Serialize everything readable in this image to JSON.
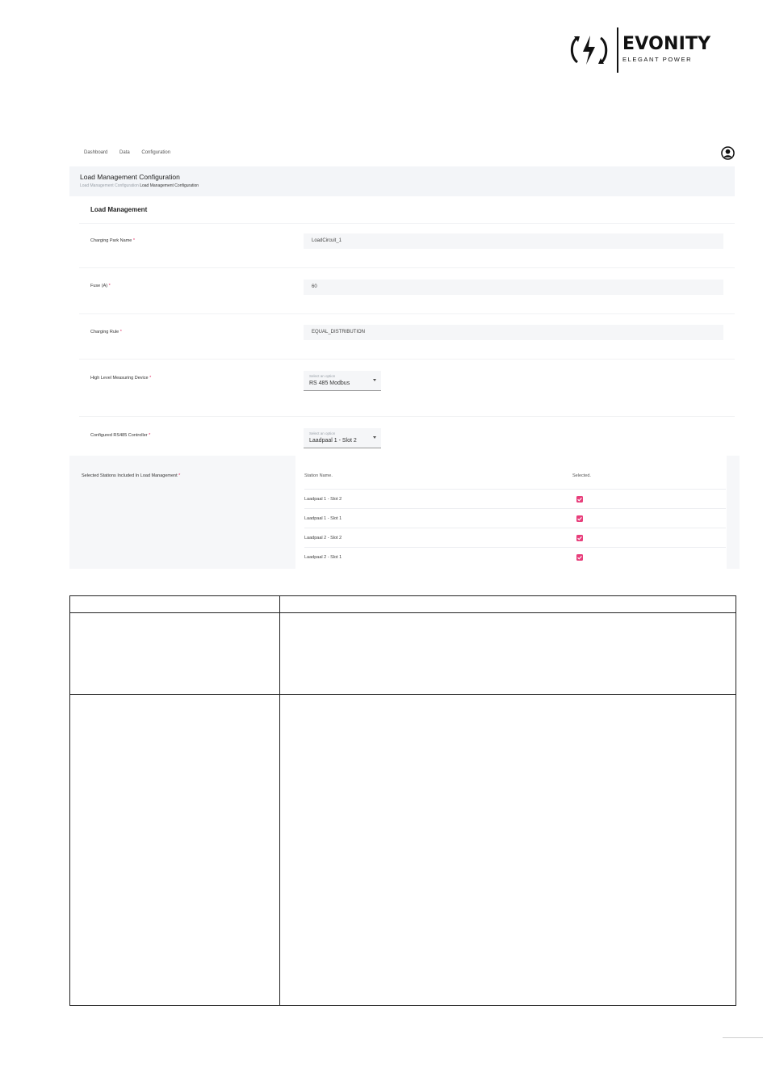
{
  "logo": {
    "wordmark": "EVONITY",
    "tagline": "ELEGANT POWER"
  },
  "nav": {
    "items": [
      "Dashboard",
      "Data",
      "Configuration"
    ],
    "user_icon": "user-circle-icon"
  },
  "page": {
    "title": "Load Management Configuration",
    "breadcrumb_parent": "Load Management Configuration",
    "breadcrumb_current": "Load Management Configuration"
  },
  "card": {
    "title": "Load Management",
    "required_marker": "*",
    "charging_park_name": {
      "label": "Charging Park Name",
      "value": "LoadCircuit_1"
    },
    "fuse": {
      "label": "Fuse (A)",
      "value": "60"
    },
    "charging_rule": {
      "label": "Charging Rule",
      "value": "EQUAL_DISTRIBUTION"
    },
    "measuring_device": {
      "label": "High Level Measuring Device",
      "hint": "Select an option",
      "value": "RS 485 Modbus"
    },
    "rs485_controller": {
      "label": "Configured RS485 Controller",
      "hint": "Select an option",
      "value": "Laadpaal 1 - Slot 2"
    }
  },
  "stations": {
    "label": "Selected Stations Included In Load Management",
    "col_name": "Station Name.",
    "col_selected": "Selected.",
    "accent": "#e83e7b",
    "rows": [
      {
        "name": "Laadpaal 1 - Slot 2",
        "selected": true
      },
      {
        "name": "Laadpaal 1 - Slot 1",
        "selected": true
      },
      {
        "name": "Laadpaal 2 - Slot 2",
        "selected": true
      },
      {
        "name": "Laadpaal 2 - Slot 1",
        "selected": true
      }
    ]
  }
}
